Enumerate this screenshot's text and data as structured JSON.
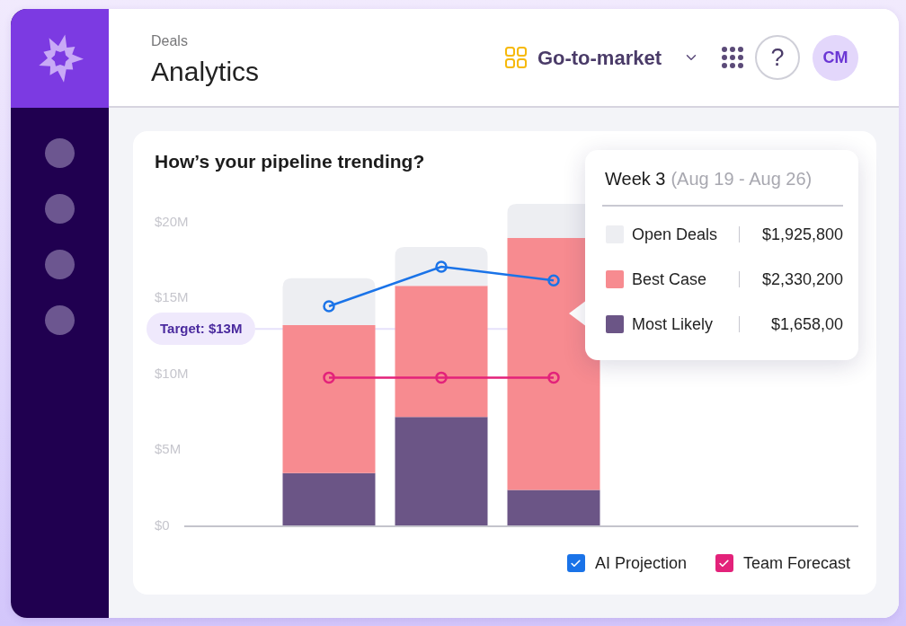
{
  "header": {
    "breadcrumb": "Deals",
    "title": "Analytics",
    "workspace": {
      "label": "Go-to-market"
    },
    "help": {
      "label": "?"
    },
    "avatar": {
      "initials": "CM"
    }
  },
  "pipeline_card": {
    "title": "How’s your pipeline trending?",
    "chart_data": [
      {
        "type": "bar",
        "stacked": true,
        "categories": [
          null,
          null,
          null,
          null,
          null,
          null
        ],
        "series": [
          {
            "name": "Most Likely",
            "color": "#6b5586",
            "values": [
              null,
              3.5,
              7.2,
              2.4,
              null,
              null
            ]
          },
          {
            "name": "Best Case",
            "color": "#f78b90",
            "values": [
              null,
              9.75,
              8.65,
              16.6,
              null,
              null
            ]
          },
          {
            "name": "Open Deals",
            "color": "#edeef2",
            "values": [
              null,
              3.1,
              2.55,
              2.25,
              null,
              null
            ]
          },
          {
            "name": "AI Projection",
            "type": "line",
            "color": "#1a73e8",
            "values": [
              null,
              14.5,
              17.1,
              16.2,
              null,
              null
            ]
          },
          {
            "name": "Team Forecast",
            "type": "line",
            "color": "#e3227a",
            "values": [
              null,
              9.8,
              9.8,
              9.8,
              null,
              null
            ]
          }
        ],
        "yticks": [
          {
            "value": 0,
            "label": "$0"
          },
          {
            "value": 5,
            "label": "$5M"
          },
          {
            "value": 10,
            "label": "$10M"
          },
          {
            "value": 15,
            "label": "$15M"
          },
          {
            "value": 20,
            "label": "$20M"
          }
        ],
        "ylim": [
          0,
          21.25
        ],
        "marker": "circle",
        "ref_lines": [
          {
            "axis": "y",
            "value": 13,
            "label": "Target: $13M",
            "color": "#e6e1fb"
          }
        ]
      }
    ],
    "tooltip": {
      "title": "Week 3",
      "range": "(Aug 19 - Aug 26)",
      "values": [
        "$1,925,800",
        "$2,330,200",
        "$1,658,00"
      ]
    },
    "legend": [
      {
        "checked": true
      },
      {
        "checked": true
      }
    ]
  }
}
